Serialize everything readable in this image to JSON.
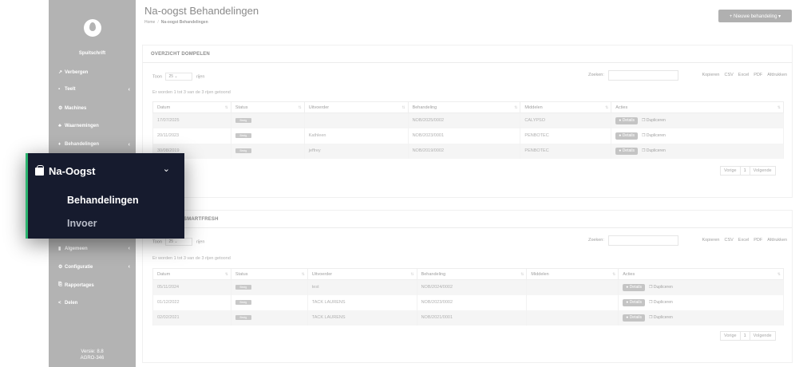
{
  "sidebar": {
    "brand": "Spuitschrift",
    "items": [
      {
        "icon": "hide-icon",
        "glyph": "↗",
        "label": "Verbergen",
        "arrow": ""
      },
      {
        "icon": "toolbox-icon",
        "glyph": "▪",
        "label": "Teelt",
        "arrow": "‹"
      },
      {
        "icon": "machines-icon",
        "glyph": "⚙",
        "label": "Machines",
        "arrow": ""
      },
      {
        "icon": "observations-icon",
        "glyph": "♣",
        "label": "Waarnemingen",
        "arrow": ""
      },
      {
        "icon": "treatments-icon",
        "glyph": "♦",
        "label": "Behandelingen",
        "arrow": "‹"
      },
      {
        "icon": "general-icon",
        "glyph": "▮",
        "label": "Algemeen",
        "arrow": "‹"
      },
      {
        "icon": "config-icon",
        "glyph": "⚙",
        "label": "Configuratie",
        "arrow": "‹"
      },
      {
        "icon": "reports-icon",
        "glyph": "⎘",
        "label": "Rapportages",
        "arrow": ""
      },
      {
        "icon": "share-icon",
        "glyph": "<",
        "label": "Delen",
        "arrow": ""
      }
    ],
    "version_line1": "Versie: 8.8",
    "version_line2": "AGRO-346"
  },
  "header": {
    "title": "Na-oogst Behandelingen",
    "breadcrumb_home": "Home",
    "breadcrumb_current": "Na-oogst Behandelingen",
    "new_button": "+ Nieuwe behandeling ▾"
  },
  "panel1": {
    "title": "OVERZICHT DOMPELEN",
    "toon_label": "Toon",
    "page_size": "25",
    "rows_label": "rijen",
    "search_label": "Zoeken:",
    "export_buttons": [
      "Kopieren",
      "CSV",
      "Excel",
      "PDF",
      "Afdrukken"
    ],
    "count_text": "Er worden 1 tot 3 van de 3 rijen getoond",
    "columns": [
      "Datum",
      "Status",
      "Uitvoerder",
      "Behandeling",
      "Middelen",
      "Acties"
    ],
    "rows": [
      {
        "datum": "17/07/2025",
        "status": "Bezig",
        "uitvoerder": "",
        "behandeling": "NOB/2025/0002",
        "middelen": "CALYPSO"
      },
      {
        "datum": "20/11/2023",
        "status": "Bezig",
        "uitvoerder": "Kathleen",
        "behandeling": "NOB/2023/0001",
        "middelen": "PENBOTEC"
      },
      {
        "datum": "30/08/2019",
        "status": "Bezig",
        "uitvoerder": "jeffrey",
        "behandeling": "NOB/2019/0002",
        "middelen": "PENBOTEC"
      }
    ],
    "details_label": "Details",
    "duplicate_label": "Dupliceren",
    "prev": "Vorige",
    "page": "1",
    "next": "Volgende"
  },
  "panel2": {
    "title": "SMARTFRESH",
    "toon_label": "Toon",
    "page_size": "25",
    "rows_label": "rijen",
    "search_label": "Zoeken:",
    "export_buttons": [
      "Kopieren",
      "CSV",
      "Excel",
      "PDF",
      "Afdrukken"
    ],
    "count_text": "Er worden 1 tot 3 van de 3 rijen getoond",
    "columns": [
      "Datum",
      "Status",
      "Uitvoerder",
      "Behandeling",
      "Middelen",
      "Acties"
    ],
    "rows": [
      {
        "datum": "05/11/2024",
        "status": "Bezig",
        "uitvoerder": "test",
        "behandeling": "NOB/2024/0002",
        "middelen": ""
      },
      {
        "datum": "01/12/2022",
        "status": "Bezig",
        "uitvoerder": "TACK LAURENS",
        "behandeling": "NOB/2023/0002",
        "middelen": ""
      },
      {
        "datum": "02/02/2021",
        "status": "Bezig",
        "uitvoerder": "TACK LAURENS",
        "behandeling": "NOB/2021/0001",
        "middelen": ""
      }
    ],
    "details_label": "Details",
    "duplicate_label": "Dupliceren",
    "prev": "Vorige",
    "page": "1",
    "next": "Volgende"
  },
  "popup": {
    "title": "Na-Oogst",
    "items": [
      "Behandelingen",
      "Invoer"
    ]
  }
}
